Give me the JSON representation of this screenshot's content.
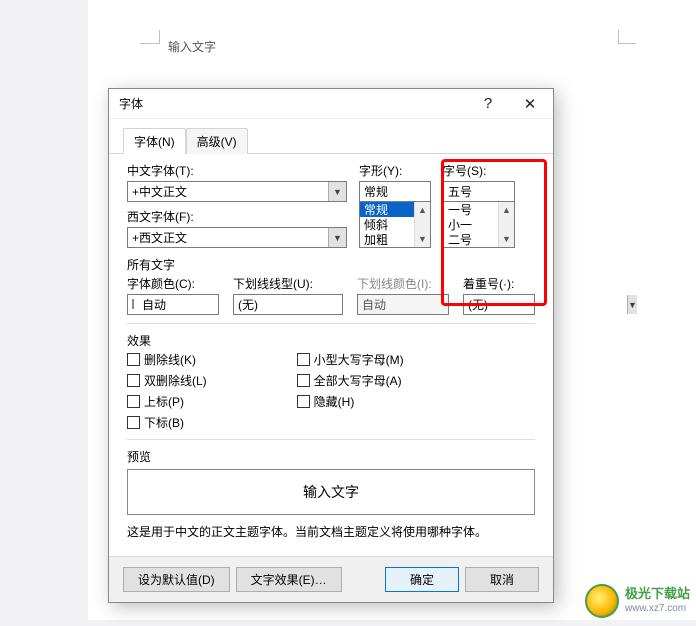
{
  "paper": {
    "placeholder": "输入文字"
  },
  "dialog": {
    "title": "字体",
    "help": "?",
    "close": "✕",
    "tabs": {
      "font": "字体(N)",
      "advanced": "高级(V)"
    },
    "labels": {
      "cn_font": "中文字体(T):",
      "en_font": "西文字体(F):",
      "style": "字形(Y):",
      "size": "字号(S):",
      "all_font": "所有文字",
      "color": "字体颜色(C):",
      "underline_style": "下划线线型(U):",
      "underline_color": "下划线颜色(I):",
      "emphasis": "着重号(·):",
      "effects": "效果",
      "preview": "预览"
    },
    "values": {
      "cn_font": "+中文正文",
      "en_font": "+西文正文",
      "style": "常规",
      "size": "五号",
      "color": "自动",
      "underline_style": "(无)",
      "underline_color": "自动",
      "emphasis": "(无)"
    },
    "style_list": [
      "常规",
      "倾斜",
      "加粗"
    ],
    "size_list": [
      "一号",
      "小一",
      "二号"
    ],
    "effects_left": [
      {
        "key": "strike",
        "label": "删除线(K)"
      },
      {
        "key": "dstrike",
        "label": "双删除线(L)"
      },
      {
        "key": "super",
        "label": "上标(P)"
      },
      {
        "key": "sub",
        "label": "下标(B)"
      }
    ],
    "effects_right": [
      {
        "key": "smallcaps",
        "label": "小型大写字母(M)"
      },
      {
        "key": "allcaps",
        "label": "全部大写字母(A)"
      },
      {
        "key": "hidden",
        "label": "隐藏(H)"
      }
    ],
    "preview_text": "输入文字",
    "note": "这是用于中文的正文主题字体。当前文档主题定义将使用哪种字体。",
    "buttons": {
      "default": "设为默认值(D)",
      "texteffect": "文字效果(E)…",
      "ok": "确定",
      "cancel": "取消"
    }
  },
  "watermark": {
    "line1": "极光下载站",
    "line2": "www.xz7.com"
  }
}
